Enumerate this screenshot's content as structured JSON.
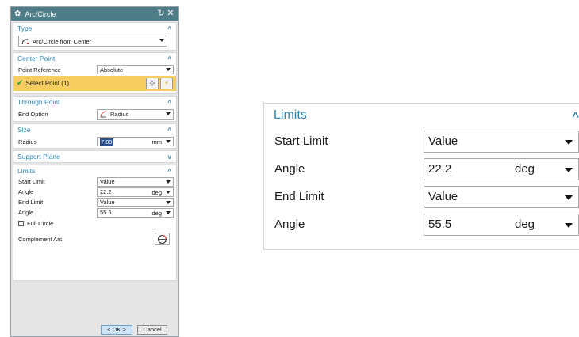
{
  "dialog": {
    "title": "Arc/Circle",
    "titlebar_icon": "gear-icon",
    "reset_icon": "reset-icon",
    "close_icon": "close-icon"
  },
  "type": {
    "header": "Type",
    "value": "Arc/Circle from Center"
  },
  "center_point": {
    "header": "Center Point",
    "point_reference_label": "Point Reference",
    "point_reference_value": "Absolute",
    "select_point_label": "Select Point (1)"
  },
  "through_point": {
    "header": "Through Point",
    "end_option_label": "End Option",
    "end_option_value": "Radius"
  },
  "size": {
    "header": "Size",
    "radius_label": "Radius",
    "radius_value": "7.89",
    "radius_unit": "mm"
  },
  "support_plane": {
    "header": "Support Plane"
  },
  "limits": {
    "header": "Limits",
    "start_limit_label": "Start Limit",
    "start_limit_value": "Value",
    "start_angle_label": "Angle",
    "start_angle_value": "22.2",
    "start_angle_unit": "deg",
    "end_limit_label": "End Limit",
    "end_limit_value": "Value",
    "end_angle_label": "Angle",
    "end_angle_value": "55.5",
    "end_angle_unit": "deg",
    "full_circle_label": "Full Circle",
    "full_circle_checked": false,
    "complement_arc_label": "Complement Arc"
  },
  "footer": {
    "ok_label": "< OK >",
    "cancel_label": "Cancel"
  },
  "zoom": {
    "header": "Limits",
    "rows": [
      {
        "label": "Start Limit",
        "value": "Value",
        "unit": ""
      },
      {
        "label": "Angle",
        "value": "22.2",
        "unit": "deg"
      },
      {
        "label": "End Limit",
        "value": "Value",
        "unit": ""
      },
      {
        "label": "Angle",
        "value": "55.5",
        "unit": "deg"
      }
    ]
  },
  "colors": {
    "titlebar": "#4e7c87",
    "section_header": "#2f86b8",
    "selection_highlight": "#f7cd62",
    "check": "#2ea02e"
  }
}
